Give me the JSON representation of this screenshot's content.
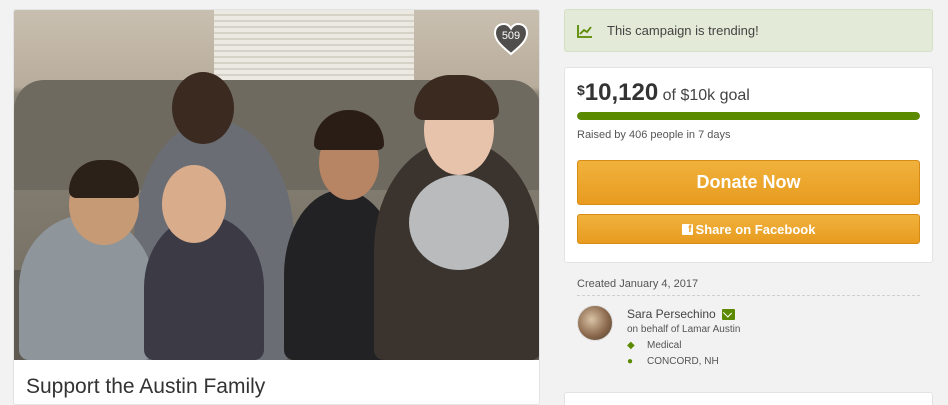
{
  "campaign": {
    "title": "Support the Austin Family",
    "favorite_count": "509"
  },
  "trending": {
    "text": "This campaign is trending!",
    "icon": "trend-chart-icon"
  },
  "goal": {
    "currency_symbol": "$",
    "amount_raised": "10,120",
    "goal_text": "of $10k goal",
    "progress_percent": 100,
    "raised_summary": "Raised by 406 people in 7 days"
  },
  "actions": {
    "donate_label": "Donate Now",
    "share_label": "Share on Facebook"
  },
  "organizer": {
    "created": "Created January 4, 2017",
    "name": "Sara Persechino",
    "on_behalf": "on behalf of Lamar Austin",
    "category": "Medical",
    "location": "CONCORD, NH"
  },
  "colors": {
    "accent_green": "#5b8a00",
    "button_orange": "#e89b1f",
    "trending_bg": "#e3ead7"
  }
}
